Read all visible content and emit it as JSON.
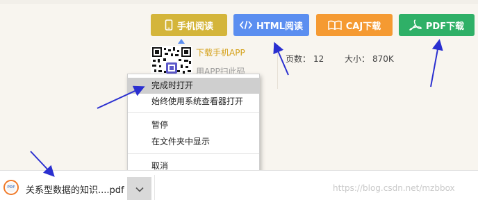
{
  "toolbar": {
    "mobile_read": "手机阅读",
    "html_read": "HTML阅读",
    "caj_download": "CAJ下载",
    "pdf_download": "PDF下载"
  },
  "qr": {
    "download_app": "下载手机APP",
    "scan_with_app": "用APP扫此码"
  },
  "doc_meta": {
    "pages_label": "页数：",
    "pages_value": "12",
    "size_label": "大小：",
    "size_value": "870K"
  },
  "context_menu": {
    "items": [
      "完成时打开",
      "始终使用系统查看器打开",
      "暂停",
      "在文件夹中显示",
      "取消"
    ]
  },
  "download": {
    "file_name": "关系型数据的知识....pdf",
    "icon_text": "PDF"
  },
  "watermark": "https://blog.csdn.net/mzbbox",
  "colors": {
    "mobile": "#d4b53a",
    "html": "#5b8ef0",
    "caj": "#f59a32",
    "pdf": "#2fb067",
    "annotation_arrow": "#2a2fd0"
  },
  "icons": {
    "mobile": "phone-icon",
    "html": "code-icon",
    "caj": "book-icon",
    "pdf": "acrobat-icon",
    "menu_toggle": "chevron-down-icon",
    "file": "pdf-file-icon"
  }
}
